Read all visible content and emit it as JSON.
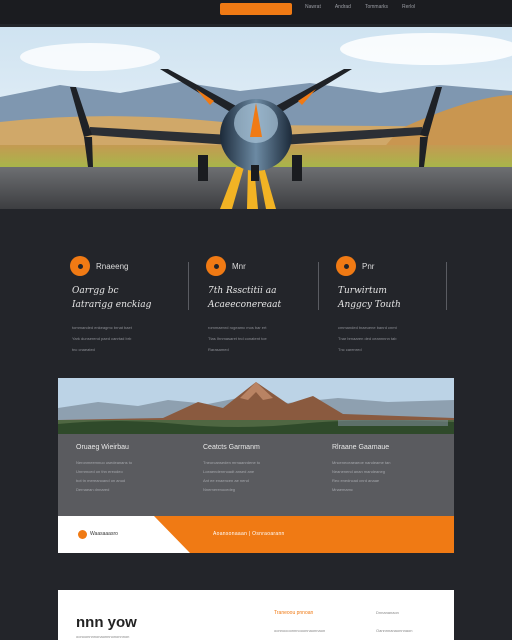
{
  "topbar": {
    "cta_label": "",
    "nav": [
      "Nawrat",
      "Andrad",
      "Tommarks",
      "Rerlol"
    ]
  },
  "features": [
    {
      "title": "Rnaeeng",
      "heading": [
        "Oarrgg bc",
        "Iatrarigg enckiag"
      ],
      "body": [
        "tommanded enkeagmc brnat baet",
        "Yark dunserend paed canrtad brb",
        "tnc cnaeated"
      ]
    },
    {
      "title": "Mnr",
      "heading": [
        "7th Rssctitii aa",
        "Acaeeconereaat"
      ],
      "body": [
        "rommaenrd rogeamc mos bar ert",
        "Ttas Ihnmasaret tnd conatent toe",
        "Rarasamed"
      ]
    },
    {
      "title": "Pnr",
      "heading": [
        "Turwirtum",
        "Anggcy Touth"
      ],
      "body": [
        "cmmanded tnaeuene banrd cnmt",
        "Tnar brnaaren ded ceannnnn tab",
        "Tnc carenred"
      ]
    }
  ],
  "card": {
    "columns": [
      {
        "title": "Oruaeg Wieirbau",
        "lines": [
          "Neronmeemnuo usedeanans to",
          "Unrnrnced on thn ereodeo",
          "bot tn mereanoand on anud",
          "Dernaean dnnared"
        ]
      },
      {
        "title": "Ceatcts Garmanm",
        "lines": [
          "Tneorcanseden mrnaanrdene to",
          "Loeaendenrnoadt ansed ane",
          "Ant ee enaencen ae nend",
          "Nnernerenocedeg"
        ]
      },
      {
        "title": "Rlraane Gaamaue",
        "lines": [
          "Mnceneceaeaeoe nandeame tan",
          "Neanenend anan mandeaneg",
          "Reo enedncad cnrd anaae",
          "Mnaemamc"
        ]
      }
    ],
    "footer_brand": "Waasaaasro",
    "footer_links": "Aoansonaaan  |  Osnraoarann"
  },
  "bottom": {
    "big_text": "nnn  yow",
    "accent": "Traneoou pnnoan",
    "small_left": "oonoonnnnonaonnnononnnon",
    "small_mid": "oonnoooonnnooonnaonnaon",
    "small_right_1": "Dnnananaon",
    "small_right_2": "Oannnnanaonnnaon"
  },
  "colors": {
    "accent": "#f07a14",
    "background": "#23252a",
    "card": "#5a5b5f"
  }
}
